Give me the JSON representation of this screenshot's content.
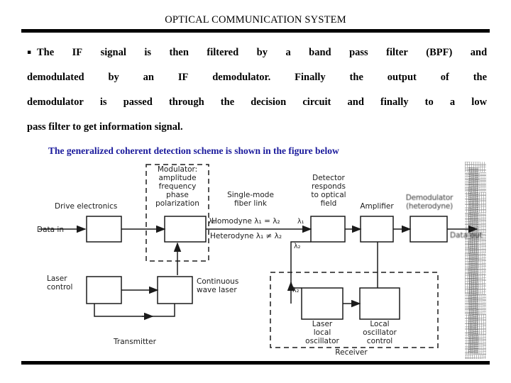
{
  "slide": {
    "title": "OPTICAL COMMUNICATION SYSTEM",
    "bullet_glyph": "▪"
  },
  "body": {
    "line1_words": [
      "The",
      "IF",
      "signal",
      "is",
      "then",
      "filtered",
      "by",
      "a",
      "band",
      "pass",
      "filter",
      "(BPF)",
      "and"
    ],
    "line2_words": [
      "demodulated",
      "by",
      "an",
      "IF",
      "demodulator.",
      "Finally",
      "the",
      "output",
      "of",
      "the"
    ],
    "line3_words": [
      "demodulator",
      "is",
      "passed",
      "through",
      "the",
      "decision",
      "circuit",
      "and",
      "finally",
      "to",
      "a",
      "low"
    ],
    "line4": "pass filter to get information signal.",
    "highlight": "The generalized coherent detection scheme is shown in the figure below",
    "highlight_color": "#1a1a9c"
  },
  "figure": {
    "name": "coherent-detection-block-diagram",
    "labels": {
      "drive_electronics": "Drive electronics",
      "data_in": "Data in",
      "modulator_title": "Modulator:",
      "modulator_l1": "amplitude",
      "modulator_l2": "frequency",
      "modulator_l3": "phase",
      "modulator_l4": "polarization",
      "lambda1_mod": "λ₁",
      "fiber_l1": "Single-mode",
      "fiber_l2": "fiber link",
      "homodyne": "Homodyne λ₁ = λ₂",
      "heterodyne": "Heterodyne λ₁ ≠ λ₂",
      "lambda1_det": "λ₁",
      "lambda2_det": "λ₂",
      "lambda2_lo": "λ₂",
      "detector_l1": "Detector",
      "detector_l2": "responds",
      "detector_l3": "to optical",
      "detector_l4": "field",
      "amplifier": "Amplifier",
      "demodulator_l1": "Demodulator",
      "demodulator_l2": "(heterodyne)",
      "data_out": "Data out",
      "laser_control_l1": "Laser",
      "laser_control_l2": "control",
      "cw_laser_l1": "Continuous",
      "cw_laser_l2": "wave laser",
      "transmitter": "Transmitter",
      "laser_lo_l1": "Laser",
      "laser_lo_l2": "local",
      "laser_lo_l3": "oscillator",
      "lo_control_l1": "Local",
      "lo_control_l2": "oscillator",
      "lo_control_l3": "control",
      "receiver": "Receiver"
    }
  }
}
